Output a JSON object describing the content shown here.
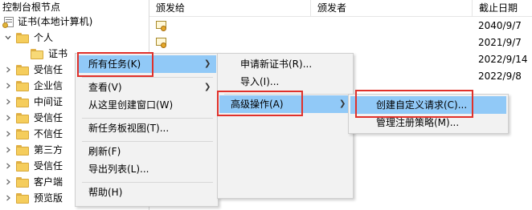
{
  "tree": {
    "header": "控制台根节点",
    "root": "证书(本地计算机)",
    "personal": "个人",
    "certificates": "证书",
    "stores": [
      "受信任",
      "企业信",
      "中间证",
      "受信任",
      "不信任",
      "第三方",
      "受信任",
      "客户端",
      "预览版"
    ]
  },
  "list": {
    "columns": [
      "颁发给",
      "颁发者",
      "截止日期"
    ],
    "expiry_dates": [
      "2040/9/7",
      "2021/9/7",
      "2022/9/14",
      "2022/9/8"
    ]
  },
  "context_menu": {
    "items": [
      "所有任务(K)",
      "查看(V)",
      "从这里创建窗口(W)",
      "新任务板视图(T)...",
      "刷新(F)",
      "导出列表(L)...",
      "帮助(H)"
    ]
  },
  "all_tasks_menu": {
    "items": [
      "申请新证书(R)...",
      "导入(I)...",
      "高级操作(A)"
    ]
  },
  "advanced_menu": {
    "items": [
      "创建自定义请求(C)...",
      "管理注册策略(M)..."
    ]
  },
  "colors": {
    "highlight": "#91c9f7",
    "annotation_box": "#e0312b",
    "folder": "#f5cd5c"
  },
  "icons": [
    "chevron-down-icon",
    "chevron-right-icon",
    "folder-icon",
    "certificate-store-icon",
    "certificate-icon",
    "submenu-arrow-icon"
  ]
}
